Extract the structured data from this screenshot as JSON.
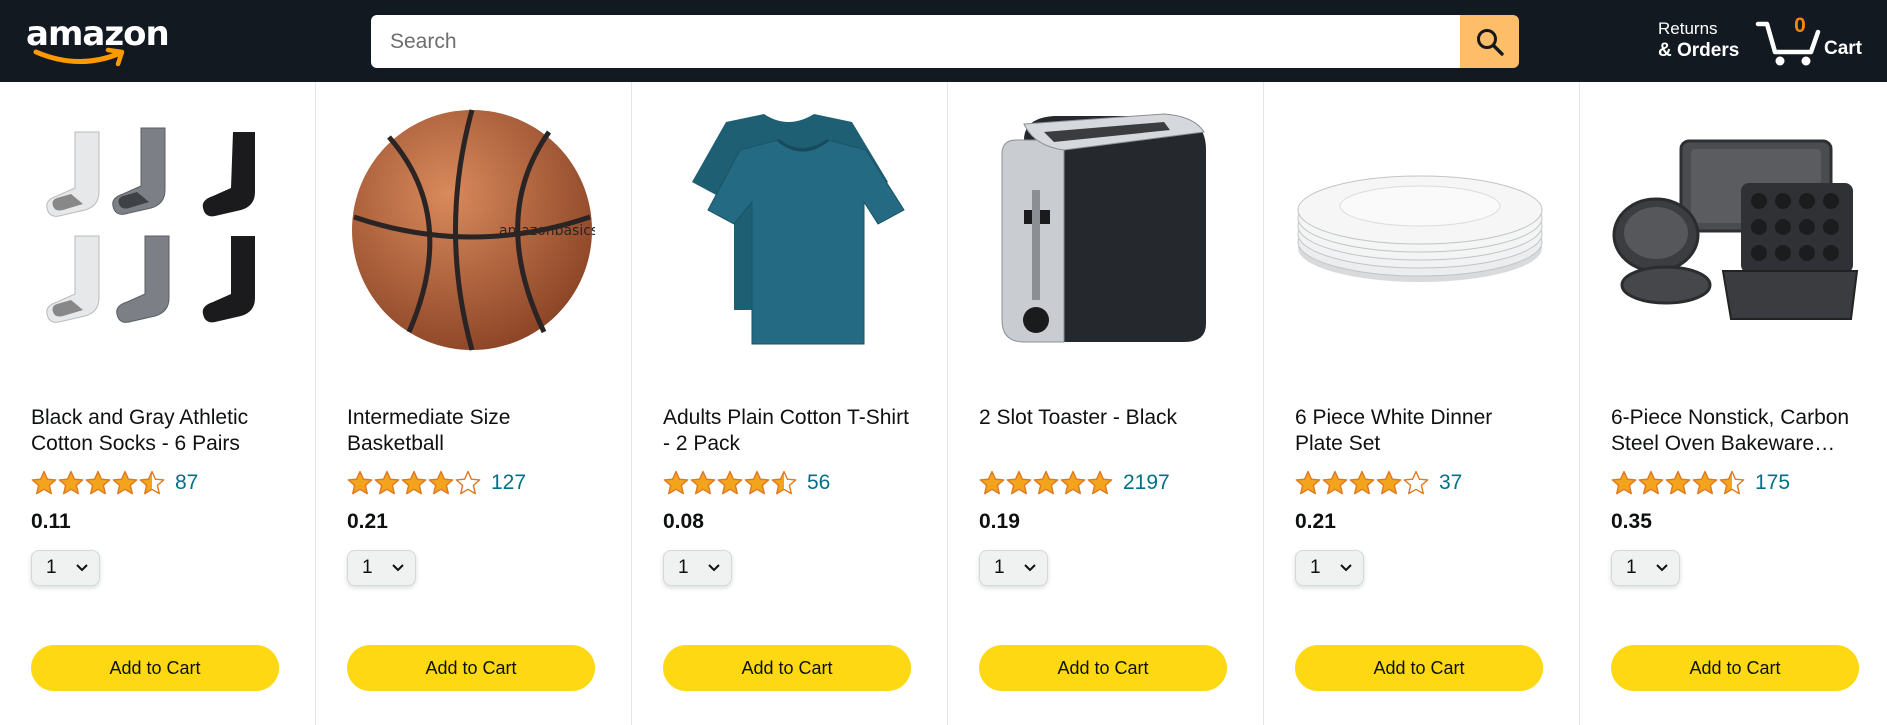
{
  "header": {
    "logo_text": "amazon",
    "search_placeholder": "Search",
    "returns_line1": "Returns",
    "returns_line2": "& Orders",
    "cart_count": "0",
    "cart_label": "Cart"
  },
  "colors": {
    "header_bg": "#131921",
    "search_button": "#febd69",
    "cart_count": "#f08804",
    "star": "#f4a41c",
    "rating_link": "#007185",
    "add_to_cart": "#ffd814"
  },
  "products": [
    {
      "name": "Black and Gray Athletic Cotton Socks - 6 Pairs",
      "image": "socks",
      "rating": 4.5,
      "rating_count": "87",
      "price": "0.11",
      "quantity": "1",
      "button": "Add to Cart"
    },
    {
      "name": "Intermediate Size Basketball",
      "image": "basketball",
      "rating": 4.0,
      "rating_count": "127",
      "price": "0.21",
      "quantity": "1",
      "button": "Add to Cart"
    },
    {
      "name": "Adults Plain Cotton T-Shirt - 2 Pack",
      "image": "tshirt",
      "rating": 4.5,
      "rating_count": "56",
      "price": "0.08",
      "quantity": "1",
      "button": "Add to Cart"
    },
    {
      "name": "2 Slot Toaster - Black",
      "image": "toaster",
      "rating": 5.0,
      "rating_count": "2197",
      "price": "0.19",
      "quantity": "1",
      "button": "Add to Cart"
    },
    {
      "name": "6 Piece White Dinner Plate Set",
      "image": "plates",
      "rating": 4.0,
      "rating_count": "37",
      "price": "0.21",
      "quantity": "1",
      "button": "Add to Cart"
    },
    {
      "name": "6-Piece Nonstick, Carbon Steel Oven Bakeware…",
      "image": "bakeware",
      "rating": 4.5,
      "rating_count": "175",
      "price": "0.35",
      "quantity": "1",
      "button": "Add to Cart"
    }
  ]
}
